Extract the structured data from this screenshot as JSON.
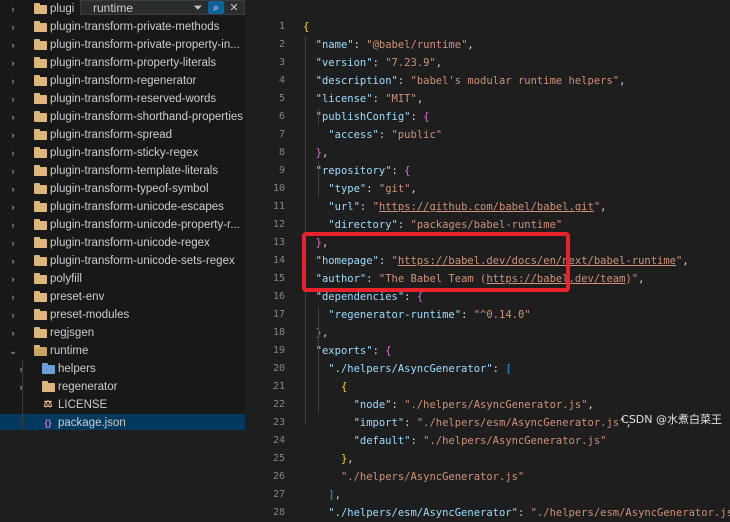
{
  "search": {
    "value": "runtime"
  },
  "tree": [
    {
      "label": "plugi",
      "kind": "folder",
      "depth": 0
    },
    {
      "label": "plugin-transform-private-methods",
      "kind": "folder",
      "depth": 0
    },
    {
      "label": "plugin-transform-private-property-in...",
      "kind": "folder",
      "depth": 0
    },
    {
      "label": "plugin-transform-property-literals",
      "kind": "folder",
      "depth": 0
    },
    {
      "label": "plugin-transform-regenerator",
      "kind": "folder",
      "depth": 0
    },
    {
      "label": "plugin-transform-reserved-words",
      "kind": "folder",
      "depth": 0
    },
    {
      "label": "plugin-transform-shorthand-properties",
      "kind": "folder",
      "depth": 0
    },
    {
      "label": "plugin-transform-spread",
      "kind": "folder",
      "depth": 0
    },
    {
      "label": "plugin-transform-sticky-regex",
      "kind": "folder",
      "depth": 0
    },
    {
      "label": "plugin-transform-template-literals",
      "kind": "folder",
      "depth": 0
    },
    {
      "label": "plugin-transform-typeof-symbol",
      "kind": "folder",
      "depth": 0
    },
    {
      "label": "plugin-transform-unicode-escapes",
      "kind": "folder",
      "depth": 0
    },
    {
      "label": "plugin-transform-unicode-property-r...",
      "kind": "folder",
      "depth": 0
    },
    {
      "label": "plugin-transform-unicode-regex",
      "kind": "folder",
      "depth": 0
    },
    {
      "label": "plugin-transform-unicode-sets-regex",
      "kind": "folder",
      "depth": 0
    },
    {
      "label": "polyfill",
      "kind": "folder",
      "depth": 0
    },
    {
      "label": "preset-env",
      "kind": "folder",
      "depth": 0
    },
    {
      "label": "preset-modules",
      "kind": "folder",
      "depth": 0
    },
    {
      "label": "regjsgen",
      "kind": "folder",
      "depth": 0
    },
    {
      "label": "runtime",
      "kind": "folder-open",
      "depth": 0
    },
    {
      "label": "helpers",
      "kind": "folder-helpers",
      "depth": 1
    },
    {
      "label": "regenerator",
      "kind": "folder",
      "depth": 1
    },
    {
      "label": "LICENSE",
      "kind": "license",
      "depth": 1
    },
    {
      "label": "package.json",
      "kind": "json",
      "depth": 1,
      "selected": true
    }
  ],
  "line_numbers": [
    "1",
    "2",
    "3",
    "4",
    "5",
    "6",
    "7",
    "8",
    "9",
    "10",
    "11",
    "12",
    "13",
    "14",
    "15",
    "16",
    "17",
    "18",
    "19",
    "20",
    "21",
    "22",
    "23",
    "24",
    "25",
    "26",
    "27",
    "28"
  ],
  "code": [
    [
      {
        "t": "{",
        "c": "b1"
      }
    ],
    [
      {
        "t": "  ",
        "c": "p"
      },
      {
        "t": "\"name\"",
        "c": "k"
      },
      {
        "t": ": ",
        "c": "p"
      },
      {
        "t": "\"@babel/runtime\"",
        "c": "s"
      },
      {
        "t": ",",
        "c": "p"
      }
    ],
    [
      {
        "t": "  ",
        "c": "p"
      },
      {
        "t": "\"version\"",
        "c": "k"
      },
      {
        "t": ": ",
        "c": "p"
      },
      {
        "t": "\"7.23.9\"",
        "c": "s"
      },
      {
        "t": ",",
        "c": "p"
      }
    ],
    [
      {
        "t": "  ",
        "c": "p"
      },
      {
        "t": "\"description\"",
        "c": "k"
      },
      {
        "t": ": ",
        "c": "p"
      },
      {
        "t": "\"babel's modular runtime helpers\"",
        "c": "s"
      },
      {
        "t": ",",
        "c": "p"
      }
    ],
    [
      {
        "t": "  ",
        "c": "p"
      },
      {
        "t": "\"license\"",
        "c": "k"
      },
      {
        "t": ": ",
        "c": "p"
      },
      {
        "t": "\"MIT\"",
        "c": "s"
      },
      {
        "t": ",",
        "c": "p"
      }
    ],
    [
      {
        "t": "  ",
        "c": "p"
      },
      {
        "t": "\"publishConfig\"",
        "c": "k"
      },
      {
        "t": ": ",
        "c": "p"
      },
      {
        "t": "{",
        "c": "b2"
      }
    ],
    [
      {
        "t": "    ",
        "c": "p"
      },
      {
        "t": "\"access\"",
        "c": "k"
      },
      {
        "t": ": ",
        "c": "p"
      },
      {
        "t": "\"public\"",
        "c": "s"
      }
    ],
    [
      {
        "t": "  ",
        "c": "p"
      },
      {
        "t": "}",
        "c": "b2"
      },
      {
        "t": ",",
        "c": "p"
      }
    ],
    [
      {
        "t": "  ",
        "c": "p"
      },
      {
        "t": "\"repository\"",
        "c": "k"
      },
      {
        "t": ": ",
        "c": "p"
      },
      {
        "t": "{",
        "c": "b2"
      }
    ],
    [
      {
        "t": "    ",
        "c": "p"
      },
      {
        "t": "\"type\"",
        "c": "k"
      },
      {
        "t": ": ",
        "c": "p"
      },
      {
        "t": "\"git\"",
        "c": "s"
      },
      {
        "t": ",",
        "c": "p"
      }
    ],
    [
      {
        "t": "    ",
        "c": "p"
      },
      {
        "t": "\"url\"",
        "c": "k"
      },
      {
        "t": ": ",
        "c": "p"
      },
      {
        "t": "\"",
        "c": "s"
      },
      {
        "t": "https://github.com/babel/babel.git",
        "c": "u"
      },
      {
        "t": "\"",
        "c": "s"
      },
      {
        "t": ",",
        "c": "p"
      }
    ],
    [
      {
        "t": "    ",
        "c": "p"
      },
      {
        "t": "\"directory\"",
        "c": "k"
      },
      {
        "t": ": ",
        "c": "p"
      },
      {
        "t": "\"packages/babel-runtime\"",
        "c": "s"
      }
    ],
    [
      {
        "t": "  ",
        "c": "p"
      },
      {
        "t": "}",
        "c": "b2"
      },
      {
        "t": ",",
        "c": "p"
      }
    ],
    [
      {
        "t": "  ",
        "c": "p"
      },
      {
        "t": "\"homepage\"",
        "c": "k"
      },
      {
        "t": ": ",
        "c": "p"
      },
      {
        "t": "\"",
        "c": "s"
      },
      {
        "t": "https://babel.dev/docs/en/next/babel-runtime",
        "c": "u"
      },
      {
        "t": "\"",
        "c": "s"
      },
      {
        "t": ",",
        "c": "p"
      }
    ],
    [
      {
        "t": "  ",
        "c": "p"
      },
      {
        "t": "\"author\"",
        "c": "k"
      },
      {
        "t": ": ",
        "c": "p"
      },
      {
        "t": "\"The Babel Team (",
        "c": "s"
      },
      {
        "t": "https://babel.dev/team",
        "c": "u"
      },
      {
        "t": ")\"",
        "c": "s"
      },
      {
        "t": ",",
        "c": "p"
      }
    ],
    [
      {
        "t": "  ",
        "c": "p"
      },
      {
        "t": "\"dependencies\"",
        "c": "k"
      },
      {
        "t": ": ",
        "c": "p"
      },
      {
        "t": "{",
        "c": "b2"
      }
    ],
    [
      {
        "t": "    ",
        "c": "p"
      },
      {
        "t": "\"regenerator-runtime\"",
        "c": "k"
      },
      {
        "t": ": ",
        "c": "p"
      },
      {
        "t": "\"^0.14.0\"",
        "c": "s"
      }
    ],
    [
      {
        "t": "  ",
        "c": "p"
      },
      {
        "t": "}",
        "c": "b2"
      },
      {
        "t": ",",
        "c": "p"
      }
    ],
    [
      {
        "t": "  ",
        "c": "p"
      },
      {
        "t": "\"exports\"",
        "c": "k"
      },
      {
        "t": ": ",
        "c": "p"
      },
      {
        "t": "{",
        "c": "b2"
      }
    ],
    [
      {
        "t": "    ",
        "c": "p"
      },
      {
        "t": "\"./helpers/AsyncGenerator\"",
        "c": "k"
      },
      {
        "t": ": ",
        "c": "p"
      },
      {
        "t": "[",
        "c": "b3"
      }
    ],
    [
      {
        "t": "      ",
        "c": "p"
      },
      {
        "t": "{",
        "c": "b1"
      }
    ],
    [
      {
        "t": "        ",
        "c": "p"
      },
      {
        "t": "\"node\"",
        "c": "k"
      },
      {
        "t": ": ",
        "c": "p"
      },
      {
        "t": "\"./helpers/AsyncGenerator.js\"",
        "c": "s"
      },
      {
        "t": ",",
        "c": "p"
      }
    ],
    [
      {
        "t": "        ",
        "c": "p"
      },
      {
        "t": "\"import\"",
        "c": "k"
      },
      {
        "t": ": ",
        "c": "p"
      },
      {
        "t": "\"./helpers/esm/AsyncGenerator.js\"",
        "c": "s"
      },
      {
        "t": ",",
        "c": "p"
      }
    ],
    [
      {
        "t": "        ",
        "c": "p"
      },
      {
        "t": "\"default\"",
        "c": "k"
      },
      {
        "t": ": ",
        "c": "p"
      },
      {
        "t": "\"./helpers/AsyncGenerator.js\"",
        "c": "s"
      }
    ],
    [
      {
        "t": "      ",
        "c": "p"
      },
      {
        "t": "}",
        "c": "b1"
      },
      {
        "t": ",",
        "c": "p"
      }
    ],
    [
      {
        "t": "      ",
        "c": "p"
      },
      {
        "t": "\"./helpers/AsyncGenerator.js\"",
        "c": "s"
      }
    ],
    [
      {
        "t": "    ",
        "c": "p"
      },
      {
        "t": "]",
        "c": "b3"
      },
      {
        "t": ",",
        "c": "p"
      }
    ],
    [
      {
        "t": "    ",
        "c": "p"
      },
      {
        "t": "\"./helpers/esm/AsyncGenerator\"",
        "c": "k"
      },
      {
        "t": ": ",
        "c": "p"
      },
      {
        "t": "\"./helpers/esm/AsyncGenerator.js\"",
        "c": "s"
      },
      {
        "t": ",",
        "c": "p"
      }
    ]
  ],
  "watermark": "CSDN @水煮白菜王",
  "colors": {
    "sidebar_bg": "#181818",
    "editor_bg": "#1e1e1e",
    "highlight": "#e8222a",
    "selected_row": "#04395e"
  }
}
